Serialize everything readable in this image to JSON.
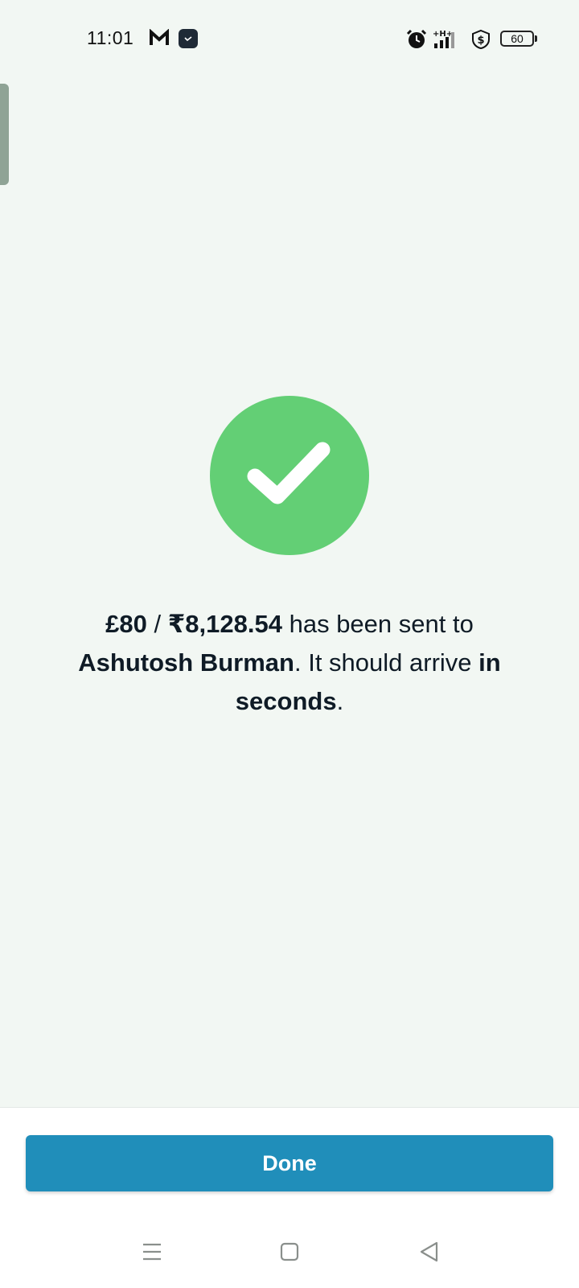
{
  "status_bar": {
    "time": "11:01",
    "battery": "60",
    "icons": [
      "gmail-icon",
      "app-icon",
      "alarm-icon",
      "signal-icon",
      "vpn-shield-icon",
      "battery-icon"
    ]
  },
  "success": {
    "icon": "checkmark-icon",
    "color": "#63cf75",
    "amount_gbp": "£80",
    "separator": " / ",
    "amount_inr": "₹8,128.54",
    "sent_text": " has been sent to ",
    "recipient": "Ashutosh Burman",
    "arrive_text": ". It should arrive ",
    "arrive_bold": "in seconds",
    "end": "."
  },
  "actions": {
    "done_label": "Done",
    "accent": "#208eba"
  },
  "nav_bar": {
    "icons": [
      "menu-icon",
      "home-icon",
      "back-icon"
    ]
  }
}
